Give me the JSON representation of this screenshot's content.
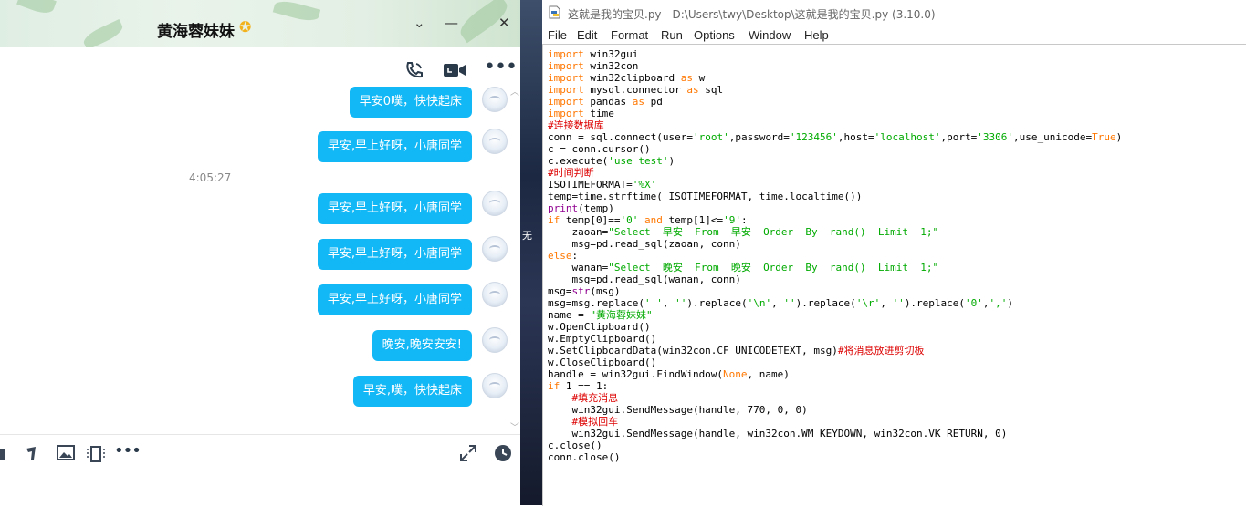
{
  "chat": {
    "title": "黄海蓉妹妹",
    "title_badge_icon": "star-icon",
    "header_buttons": [
      "chevron-down-icon",
      "minimize-icon",
      "close-icon"
    ],
    "top_actions": [
      "phone-call-icon",
      "video-call-icon",
      "more-icon"
    ],
    "time_separator": "4:05:27",
    "messages": [
      {
        "text": "早安0噗，快快起床"
      },
      {
        "text": "早安,早上好呀，小唐同学"
      },
      {
        "text": "早安,早上好呀，小唐同学"
      },
      {
        "text": "早安,早上好呀，小唐同学"
      },
      {
        "text": "早安,早上好呀，小唐同学"
      },
      {
        "text": "晚安,晚安安安!"
      },
      {
        "text": "早安,噗，快快起床"
      }
    ],
    "bottom_tools": [
      "folder-icon",
      "scissors-icon",
      "image-icon",
      "screen-capture-icon",
      "more-icon",
      "expand-icon",
      "history-clock-icon"
    ],
    "colors": {
      "bubble": "#12b7f5",
      "bubble_text": "#ffffff"
    }
  },
  "strip": {
    "text": "无"
  },
  "idle": {
    "title": "这就是我的宝贝.py - D:\\Users\\twy\\Desktop\\这就是我的宝贝.py (3.10.0)",
    "menu": [
      "File",
      "Edit",
      "Format",
      "Run",
      "Options",
      "Window",
      "Help"
    ],
    "code": [
      [
        {
          "t": "import",
          "c": "kw"
        },
        {
          "t": " win32gui"
        }
      ],
      [
        {
          "t": "import",
          "c": "kw"
        },
        {
          "t": " win32con"
        }
      ],
      [
        {
          "t": "import",
          "c": "kw"
        },
        {
          "t": " win32clipboard "
        },
        {
          "t": "as",
          "c": "kw"
        },
        {
          "t": " w"
        }
      ],
      [
        {
          "t": "import",
          "c": "kw"
        },
        {
          "t": " mysql.connector "
        },
        {
          "t": "as",
          "c": "kw"
        },
        {
          "t": " sql"
        }
      ],
      [
        {
          "t": "import",
          "c": "kw"
        },
        {
          "t": " pandas "
        },
        {
          "t": "as",
          "c": "kw"
        },
        {
          "t": " pd"
        }
      ],
      [
        {
          "t": "import",
          "c": "kw"
        },
        {
          "t": " time"
        }
      ],
      [
        {
          "t": "#连接数据库",
          "c": "cm"
        }
      ],
      [
        {
          "t": "conn = sql.connect(user="
        },
        {
          "t": "'root'",
          "c": "st"
        },
        {
          "t": ",password="
        },
        {
          "t": "'123456'",
          "c": "st"
        },
        {
          "t": ",host="
        },
        {
          "t": "'localhost'",
          "c": "st"
        },
        {
          "t": ",port="
        },
        {
          "t": "'3306'",
          "c": "st"
        },
        {
          "t": ",use_unicode="
        },
        {
          "t": "True",
          "c": "kw"
        },
        {
          "t": ")"
        }
      ],
      [
        {
          "t": "c = conn.cursor()"
        }
      ],
      [
        {
          "t": "c.execute("
        },
        {
          "t": "'use test'",
          "c": "st"
        },
        {
          "t": ")"
        }
      ],
      [
        {
          "t": "#时间判断",
          "c": "cm"
        }
      ],
      [
        {
          "t": "ISOTIMEFORMAT="
        },
        {
          "t": "'%X'",
          "c": "st"
        }
      ],
      [
        {
          "t": "temp=time.strftime( ISOTIMEFORMAT, time.localtime())"
        }
      ],
      [
        {
          "t": "print",
          "c": "bi"
        },
        {
          "t": "(temp)"
        }
      ],
      [
        {
          "t": "if",
          "c": "kw"
        },
        {
          "t": " temp[0]=="
        },
        {
          "t": "'0'",
          "c": "st"
        },
        {
          "t": " "
        },
        {
          "t": "and",
          "c": "kw"
        },
        {
          "t": " temp[1]<="
        },
        {
          "t": "'9'",
          "c": "st"
        },
        {
          "t": ":"
        }
      ],
      [
        {
          "t": "    zaoan="
        },
        {
          "t": "\"Select  早安  From  早安  Order  By  rand()  Limit  1;\"",
          "c": "st"
        }
      ],
      [
        {
          "t": "    msg=pd.read_sql(zaoan, conn)"
        }
      ],
      [
        {
          "t": "else",
          "c": "kw"
        },
        {
          "t": ":"
        }
      ],
      [
        {
          "t": "    wanan="
        },
        {
          "t": "\"Select  晚安  From  晚安  Order  By  rand()  Limit  1;\"",
          "c": "st"
        }
      ],
      [
        {
          "t": "    msg=pd.read_sql(wanan, conn)"
        }
      ],
      [
        {
          "t": "msg="
        },
        {
          "t": "str",
          "c": "bi"
        },
        {
          "t": "(msg)"
        }
      ],
      [
        {
          "t": "msg=msg.replace("
        },
        {
          "t": "' '",
          "c": "st"
        },
        {
          "t": ", "
        },
        {
          "t": "''",
          "c": "st"
        },
        {
          "t": ").replace("
        },
        {
          "t": "'\\n'",
          "c": "st"
        },
        {
          "t": ", "
        },
        {
          "t": "''",
          "c": "st"
        },
        {
          "t": ").replace("
        },
        {
          "t": "'\\r'",
          "c": "st"
        },
        {
          "t": ", "
        },
        {
          "t": "''",
          "c": "st"
        },
        {
          "t": ").replace("
        },
        {
          "t": "'0'",
          "c": "st"
        },
        {
          "t": ","
        },
        {
          "t": "','",
          "c": "st"
        },
        {
          "t": ")"
        }
      ],
      [
        {
          "t": "name = "
        },
        {
          "t": "\"黄海蓉妹妹\"",
          "c": "st"
        }
      ],
      [
        {
          "t": "w.OpenClipboard()"
        }
      ],
      [
        {
          "t": "w.EmptyClipboard()"
        }
      ],
      [
        {
          "t": "w.SetClipboardData(win32con.CF_UNICODETEXT, msg)"
        },
        {
          "t": "#将消息放进剪切板",
          "c": "cm"
        }
      ],
      [
        {
          "t": "w.CloseClipboard()"
        }
      ],
      [
        {
          "t": "handle = win32gui.FindWindow("
        },
        {
          "t": "None",
          "c": "kw"
        },
        {
          "t": ", name)"
        }
      ],
      [
        {
          "t": "if",
          "c": "kw"
        },
        {
          "t": " 1 == 1:"
        }
      ],
      [
        {
          "t": "    "
        },
        {
          "t": "#填充消息",
          "c": "cm"
        }
      ],
      [
        {
          "t": "    win32gui.SendMessage(handle, 770, 0, 0)"
        }
      ],
      [
        {
          "t": "    "
        },
        {
          "t": "#模拟回车",
          "c": "cm"
        }
      ],
      [
        {
          "t": "    win32gui.SendMessage(handle, win32con.WM_KEYDOWN, win32con.VK_RETURN, 0)"
        }
      ],
      [
        {
          "t": "c.close()"
        }
      ],
      [
        {
          "t": "conn.close()"
        }
      ]
    ],
    "colors": {
      "keyword": "#ff7700",
      "string": "#00aa00",
      "comment": "#dd0000",
      "builtin": "#900090"
    }
  }
}
